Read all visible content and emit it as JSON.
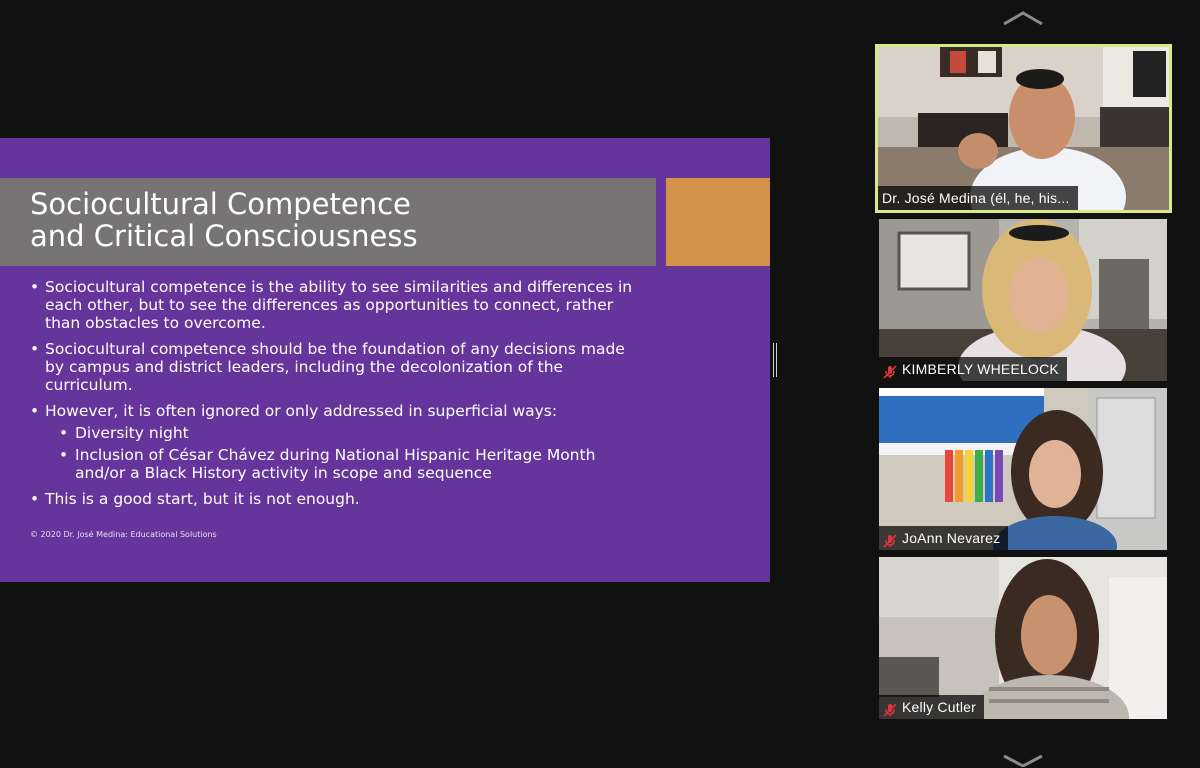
{
  "slide": {
    "title": "Sociocultural Competence\nand Critical Consciousness",
    "bullets": [
      "Sociocultural competence is the ability to see similarities and differences in each other, but to see the differences as opportunities to connect, rather than obstacles to overcome.",
      "Sociocultural competence should be the foundation of any decisions made by campus and district leaders, including the decolonization of the curriculum.",
      "However, it is often ignored or only addressed in superficial ways:",
      "This is a good start, but it is not enough."
    ],
    "sub_bullets": [
      "Diversity night",
      "Inclusion of César Chávez during National Hispanic Heritage Month and/or a Black History activity in scope and sequence"
    ],
    "copyright": "© 2020 Dr. José Medina: Educational Solutions",
    "colors": {
      "background": "#65359b",
      "title_bar": "#777476",
      "accent": "#d39247"
    }
  },
  "gallery": {
    "scroll_up_icon": "chevron-up-icon",
    "scroll_down_icon": "chevron-down-icon",
    "active_speaker_border": "#d8e98b",
    "participants": [
      {
        "name": "Dr. José Medina (él, he, his...",
        "muted": false,
        "active": true
      },
      {
        "name": "KIMBERLY WHEELOCK",
        "muted": true,
        "active": false
      },
      {
        "name": "JoAnn Nevarez",
        "muted": true,
        "active": false
      },
      {
        "name": "Kelly Cutler",
        "muted": true,
        "active": false
      }
    ]
  }
}
